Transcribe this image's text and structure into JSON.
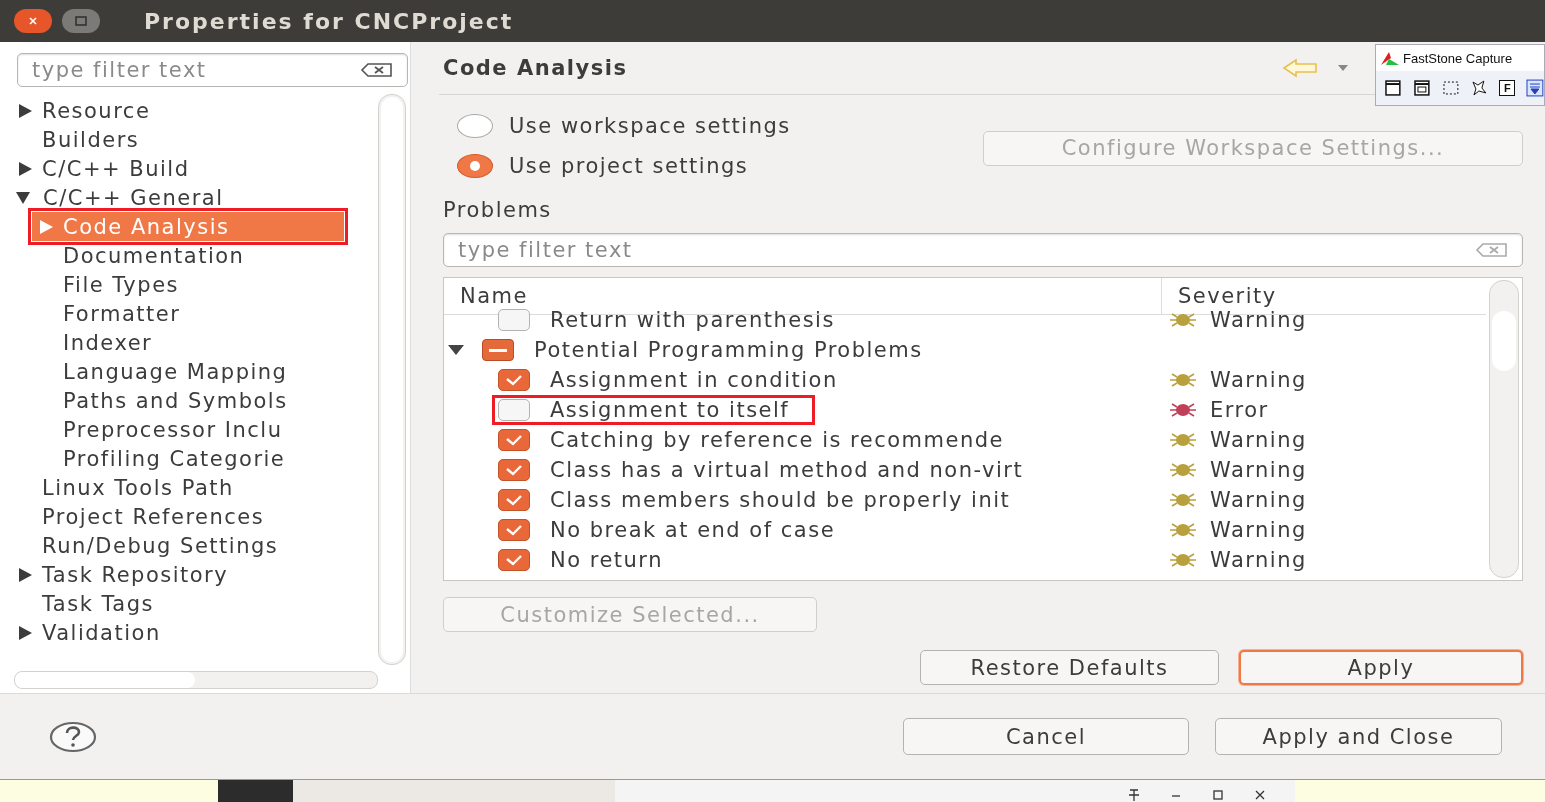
{
  "window": {
    "title": "Properties for CNCProject"
  },
  "sidebar": {
    "filter": {
      "placeholder": "type filter text"
    },
    "items": [
      {
        "label": "Resource",
        "expanded": false,
        "selected": false,
        "annotated": false
      },
      {
        "label": "Builders",
        "selected": false,
        "annotated": false
      },
      {
        "label": "C/C++ Build",
        "expanded": false,
        "selected": false,
        "annotated": false
      },
      {
        "label": "C/C++ General",
        "expanded": true,
        "selected": false,
        "annotated": false,
        "children": [
          {
            "label": "Code Analysis",
            "expanded": false,
            "selected": true,
            "annotated": true
          },
          {
            "label": "Documentation",
            "selected": false,
            "annotated": false
          },
          {
            "label": "File Types",
            "selected": false,
            "annotated": false
          },
          {
            "label": "Formatter",
            "selected": false,
            "annotated": false
          },
          {
            "label": "Indexer",
            "selected": false,
            "annotated": false
          },
          {
            "label": "Language Mapping",
            "selected": false,
            "annotated": false
          },
          {
            "label": "Paths and Symbols",
            "selected": false,
            "annotated": false
          },
          {
            "label": "Preprocessor Inclu",
            "selected": false,
            "annotated": false
          },
          {
            "label": "Profiling Categorie",
            "selected": false,
            "annotated": false
          }
        ]
      },
      {
        "label": "Linux Tools Path",
        "selected": false,
        "annotated": false
      },
      {
        "label": "Project References",
        "selected": false,
        "annotated": false
      },
      {
        "label": "Run/Debug Settings",
        "selected": false,
        "annotated": false
      },
      {
        "label": "Task Repository",
        "expanded": false,
        "selected": false,
        "annotated": false
      },
      {
        "label": "Task Tags",
        "selected": false,
        "annotated": false
      },
      {
        "label": "Validation",
        "expanded": false,
        "selected": false,
        "annotated": false
      }
    ]
  },
  "page": {
    "title": "Code Analysis",
    "scope": [
      {
        "label": "Use workspace settings",
        "selected": false
      },
      {
        "label": "Use project settings",
        "selected": true
      }
    ],
    "configure_button": {
      "label": "Configure Workspace Settings...",
      "disabled": true
    },
    "problems_label": "Problems",
    "filter": {
      "placeholder": "type filter text"
    },
    "table": {
      "columns": [
        "Name",
        "Severity"
      ],
      "rows": [
        {
          "kind": "check",
          "name": "Return with parenthesis",
          "checked": false,
          "severity": "Warning",
          "color": "#b8a03c",
          "annotated": false
        },
        {
          "kind": "group",
          "name": "Potential Programming Problems",
          "expanded": true,
          "children": [
            {
              "kind": "check",
              "name": "Assignment in condition",
              "checked": true,
              "severity": "Warning",
              "color": "#b8a03c",
              "annotated": false
            },
            {
              "kind": "check",
              "name": "Assignment to itself",
              "checked": false,
              "severity": "Error",
              "color": "#c0405a",
              "annotated": true
            },
            {
              "kind": "check",
              "name": "Catching by reference is recommende",
              "checked": true,
              "severity": "Warning",
              "color": "#b8a03c",
              "annotated": false
            },
            {
              "kind": "check",
              "name": "Class has a virtual method and non-virt",
              "checked": true,
              "severity": "Warning",
              "color": "#b8a03c",
              "annotated": false
            },
            {
              "kind": "check",
              "name": "Class members should be properly init",
              "checked": true,
              "severity": "Warning",
              "color": "#b8a03c",
              "annotated": false
            },
            {
              "kind": "check",
              "name": "No break at end of case",
              "checked": true,
              "severity": "Warning",
              "color": "#b8a03c",
              "annotated": false
            },
            {
              "kind": "check",
              "name": "No return",
              "checked": true,
              "severity": "Warning",
              "color": "#b8a03c",
              "annotated": false
            }
          ]
        }
      ]
    },
    "customize_button": {
      "label": "Customize Selected...",
      "disabled": true
    },
    "restore_button": "Restore Defaults",
    "apply_button": "Apply"
  },
  "footer": {
    "buttons": [
      "Cancel",
      "Apply and Close"
    ]
  },
  "capture_toolbar": {
    "title": "FastStone Capture",
    "tool_letter": "F"
  }
}
